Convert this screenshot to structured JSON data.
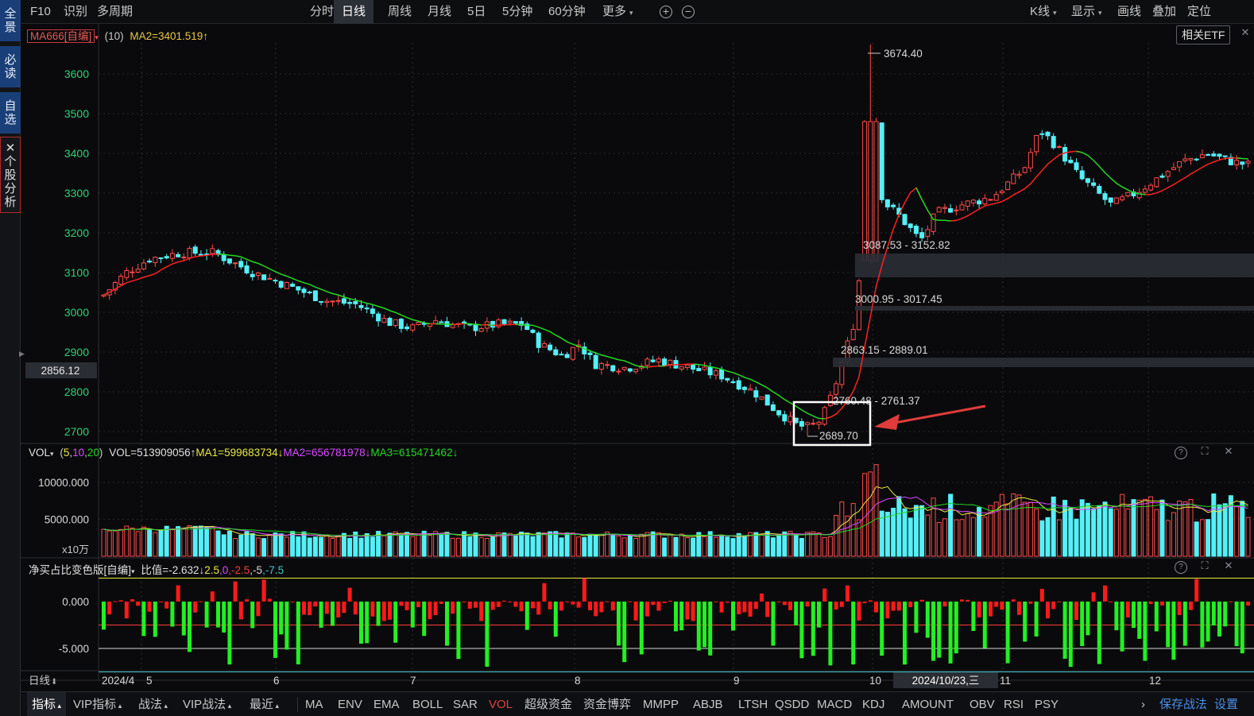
{
  "sidebar": {
    "tabs": [
      {
        "chars": [
          "全",
          "景"
        ]
      },
      {
        "chars": [
          "必",
          "读"
        ]
      },
      {
        "chars": [
          "自",
          "选"
        ]
      },
      {
        "chars": [
          "✕",
          "个",
          "股",
          "分",
          "析"
        ]
      }
    ]
  },
  "topbar": {
    "left": [
      "F10",
      "识别",
      "多周期"
    ],
    "periods": [
      "分时",
      "日线",
      "周线",
      "月线",
      "5日",
      "5分钟",
      "60分钟",
      "更多"
    ],
    "active_period": "日线",
    "right": [
      "K线",
      "显示",
      "画线",
      "叠加",
      "定位"
    ]
  },
  "main_panel": {
    "indicator": "MA666[自编]",
    "param": "(10)",
    "ma2": "MA2=3401.519↑",
    "etf_button": "相关ETF",
    "price_axis": [
      "3600",
      "3500",
      "3400",
      "3300",
      "3200",
      "3100",
      "3000",
      "2900",
      "2800",
      "2700"
    ],
    "crosshair_price": "2856.12",
    "annotations": {
      "high": "3674.40",
      "low": "2689.70",
      "gap1": "3087.53 - 3152.82",
      "gap2": "3000.95 - 3017.45",
      "gap3": "2863.15 - 2889.01",
      "gap4": "2760.48 - 2761.37"
    }
  },
  "vol_panel": {
    "label": "VOL",
    "params": [
      "5",
      "10",
      "20"
    ],
    "vol": "VOL=513909056↑",
    "ma1": "MA1=599683734↓",
    "ma2": "MA2=656781978↓",
    "ma3": "MA3=615471462↓",
    "axis": [
      "10000.000",
      "5000.000"
    ],
    "unit": "x10万"
  },
  "ratio_panel": {
    "label": "净买占比变色版[自编]",
    "value": "比值=-2.632↓",
    "levels": [
      {
        "text": "2.5",
        "color": "#e8e840"
      },
      {
        "text": "0",
        "color": "#d84aff"
      },
      {
        "text": "-2.5",
        "color": "#ff3a3a"
      },
      {
        "text": "-5",
        "color": "#d8d8d8"
      },
      {
        "text": "-7.5",
        "color": "#40c8c8"
      }
    ],
    "axis": [
      "0.000",
      "-5.000"
    ]
  },
  "date_axis": {
    "period_label": "日线",
    "labels": [
      "2024/4",
      "5",
      "6",
      "7",
      "8",
      "9",
      "10",
      "11",
      "12"
    ],
    "cursor_date": "2024/10/23,三"
  },
  "bottombar": {
    "tabs": [
      "指标",
      "VIP指标",
      "战法",
      "VIP战法",
      "最近"
    ],
    "indicators": [
      "MA",
      "ENV",
      "EMA",
      "BOLL",
      "SAR",
      "VOL",
      "超级资金",
      "资金博弈",
      "MMPP",
      "ABJB",
      "LTSH",
      "QSDD",
      "MACD",
      "KDJ",
      "AMOUNT",
      "OBV",
      "RSI",
      "PSY"
    ],
    "active_indicator": "VOL",
    "right": [
      "保存战法",
      "设置"
    ]
  },
  "colors": {
    "up": "#ff4a4a",
    "down": "#54f0f8",
    "ma_green": "#22d822",
    "ma_red": "#ff2020",
    "ratio_red": "#ff1a1a",
    "ratio_green": "#22f022"
  }
}
